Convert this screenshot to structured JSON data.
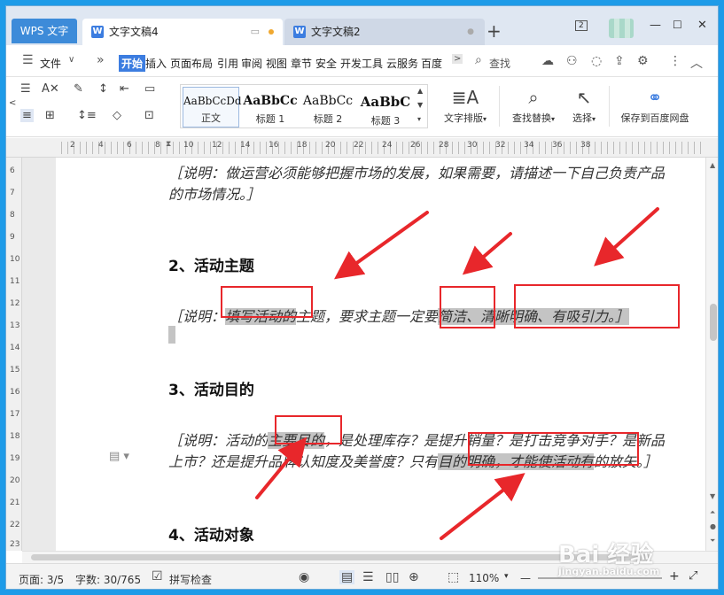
{
  "titlebar": {
    "app_tab": "WPS 文字",
    "tabs": [
      {
        "label": "文字文稿4",
        "active": true
      },
      {
        "label": "文字文稿2",
        "active": false
      }
    ],
    "plus": "+",
    "badge": "2"
  },
  "menubar": {
    "file": "文件",
    "items": [
      "开始",
      "插入",
      "页面布局",
      "引用",
      "审阅",
      "视图",
      "章节",
      "安全",
      "开发工具",
      "云服务",
      "百度"
    ],
    "search": "查找"
  },
  "ribbon": {
    "styles": [
      {
        "sample": "AaBbCcDd",
        "name": "正文"
      },
      {
        "sample": "AaBbCc",
        "name": "标题 1"
      },
      {
        "sample": "AaBbCc",
        "name": "标题 2"
      },
      {
        "sample": "AaBbC",
        "name": "标题 3"
      }
    ],
    "text_layout": "文字排版",
    "find_replace": "查找替换",
    "select": "选择",
    "save_baidu": "保存到百度网盘"
  },
  "ruler": {
    "h_numbers": [
      "2",
      "4",
      "6",
      "8",
      "10",
      "12",
      "14",
      "16",
      "18",
      "20",
      "22",
      "24",
      "26",
      "28",
      "30",
      "32",
      "34",
      "36",
      "38"
    ],
    "v_numbers": [
      "6",
      "7",
      "8",
      "9",
      "10",
      "11",
      "12",
      "13",
      "14",
      "15",
      "16",
      "17",
      "18",
      "19",
      "20",
      "21",
      "22",
      "23"
    ]
  },
  "document": {
    "line_top_1": "［说明：做运营必须能够把握市场的发展，如果需要，请描述一下自己负责产品",
    "line_top_2": "的市场情况。］",
    "heading2": "2、活动主题",
    "p2_a": "［说明：",
    "p2_hl1": "填写活动的",
    "p2_b": "主题，要求主题一定要",
    "p2_hl2": "简洁、清晰明确、有吸引力。］",
    "heading3": "3、活动目的",
    "p3_a": "［说明：活动的",
    "p3_hl1": "主要目的",
    "p3_b": "，是处理库存？是提升销量？是打击竞争对手？是新品",
    "p3_c": "上市？还是提升品牌认知度及美誉度？只有",
    "p3_hl2": "目的明确，才能使活动有",
    "p3_d": "的放矢。］",
    "heading4": "4、活动对象"
  },
  "status": {
    "page": "页面: 3/5",
    "words": "字数: 30/765",
    "spell": "拼写检查",
    "zoom": "110%"
  },
  "watermark": {
    "text": "Bai 经验",
    "url": "jingyan.baidu.com"
  },
  "colors": {
    "accent": "#3c7de0",
    "annotation": "#e8272b",
    "highlight": "#c4c4c4",
    "desktop": "#1e9be8"
  }
}
